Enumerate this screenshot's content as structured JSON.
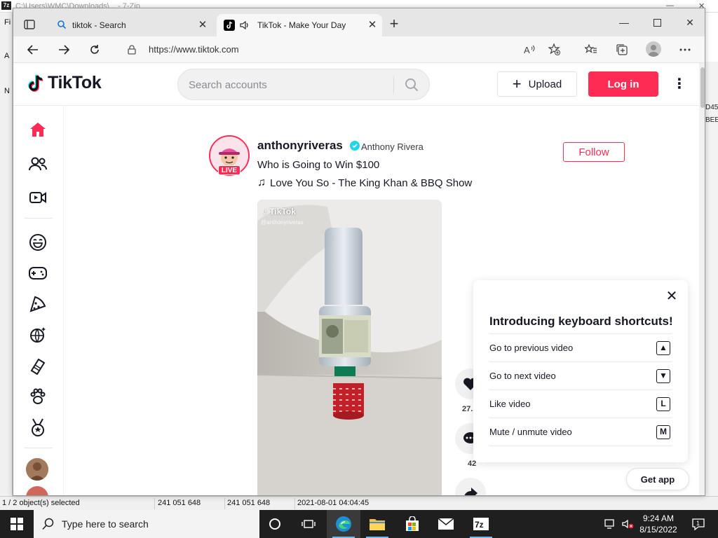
{
  "background_app": {
    "title_text": "C:\\Users\\WMC\\Downloads\\... - 7-Zip",
    "left_labels": [
      "Fi",
      "A",
      "N"
    ],
    "right_labels": [
      "D45",
      "BEE"
    ],
    "status": {
      "selected": "1 / 2 object(s) selected",
      "size": "241 051 648",
      "packed": "241 051 648",
      "modified": "2021-08-01 04:04:45"
    }
  },
  "browser": {
    "tabs": [
      {
        "title": "tiktok - Search",
        "icon": "search-icon"
      },
      {
        "title": "TikTok - Make Your Day",
        "icon": "tiktok-icon"
      }
    ],
    "url": "https://www.tiktok.com"
  },
  "tiktok": {
    "logo_text": "TikTok",
    "search_placeholder": "Search accounts",
    "upload_label": "Upload",
    "login_label": "Log in",
    "post": {
      "username": "anthonyriveras",
      "nickname": "Anthony Rivera",
      "live_badge": "LIVE",
      "caption": "Who is Going to Win $100",
      "music": "Love You So - The King Khan & BBQ Show",
      "follow_label": "Follow",
      "watermark": "TikTok",
      "watermark_handle": "@anthonyriveras",
      "like_count": "27.",
      "comment_count": "42"
    },
    "shortcuts": {
      "title": "Introducing keyboard shortcuts!",
      "items": [
        {
          "label": "Go to previous video",
          "key": "▲"
        },
        {
          "label": "Go to next video",
          "key": "▼"
        },
        {
          "label": "Like video",
          "key": "L"
        },
        {
          "label": "Mute / unmute video",
          "key": "M"
        }
      ]
    },
    "get_app_label": "Get app",
    "brand_color": "#fe2c55"
  },
  "taskbar": {
    "search_placeholder": "Type here to search",
    "time": "9:24 AM",
    "date": "8/15/2022",
    "notification_count": "1"
  }
}
